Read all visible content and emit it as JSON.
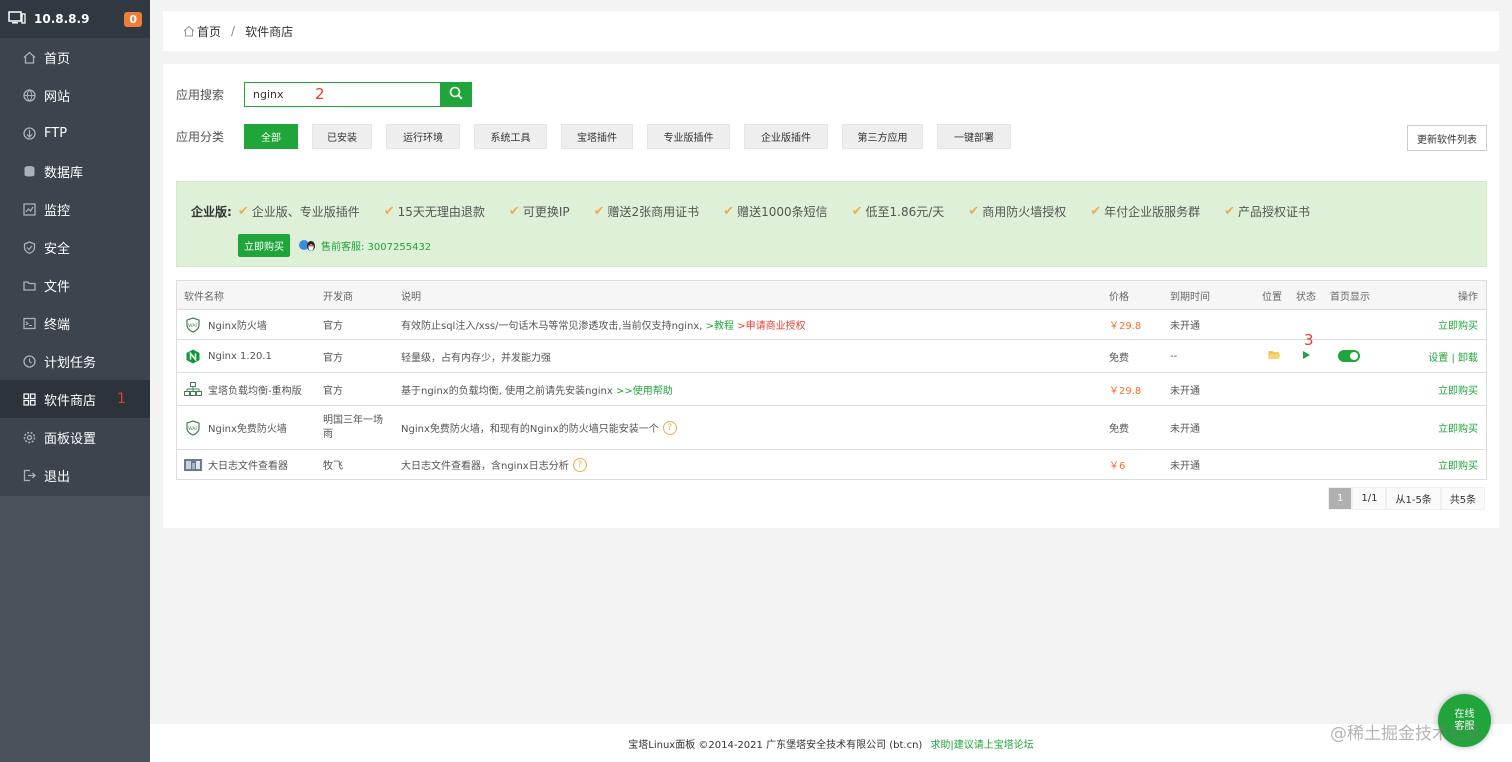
{
  "sidebar": {
    "host": "10.8.8.9",
    "badge": "0",
    "items": [
      {
        "label": "首页",
        "icon": "home-icon"
      },
      {
        "label": "网站",
        "icon": "globe-icon"
      },
      {
        "label": "FTP",
        "icon": "ftp-icon"
      },
      {
        "label": "数据库",
        "icon": "database-icon"
      },
      {
        "label": "监控",
        "icon": "monitor-icon"
      },
      {
        "label": "安全",
        "icon": "shield-icon"
      },
      {
        "label": "文件",
        "icon": "folder-icon"
      },
      {
        "label": "终端",
        "icon": "terminal-icon"
      },
      {
        "label": "计划任务",
        "icon": "clock-icon"
      },
      {
        "label": "软件商店",
        "icon": "grid-icon",
        "active": true,
        "marker": "1"
      },
      {
        "label": "面板设置",
        "icon": "gear-icon"
      },
      {
        "label": "退出",
        "icon": "logout-icon"
      }
    ]
  },
  "breadcrumb": {
    "home": "首页",
    "sep": "/",
    "current": "软件商店"
  },
  "search": {
    "label": "应用搜索",
    "value": "nginx",
    "marker": "2"
  },
  "categories": {
    "label": "应用分类",
    "items": [
      "全部",
      "已安装",
      "运行环境",
      "系统工具",
      "宝塔插件",
      "专业版插件",
      "企业版插件",
      "第三方应用",
      "一键部署"
    ],
    "refresh": "更新软件列表"
  },
  "promo": {
    "title": "企业版:",
    "features": [
      "企业版、专业版插件",
      "15天无理由退款",
      "可更换IP",
      "赠送2张商用证书",
      "赠送1000条短信",
      "低至1.86元/天",
      "商用防火墙授权",
      "年付企业版服务群",
      "产品授权证书"
    ],
    "buy": "立即购买",
    "service": "售前客服: 3007255432"
  },
  "table": {
    "headers": [
      "软件名称",
      "开发商",
      "说明",
      "价格",
      "到期时间",
      "位置",
      "状态",
      "首页显示",
      "操作"
    ],
    "rows": [
      {
        "name": "Nginx防火墙",
        "vendor": "官方",
        "desc": "有效防止sql注入/xss/一句话木马等常见渗透攻击,当前仅支持nginx, ",
        "link1": ">教程",
        "link2": ">申请商业授权",
        "price": "￥29.8",
        "expire": "未开通",
        "action": "立即购买"
      },
      {
        "name": "Nginx 1.20.1",
        "vendor": "官方",
        "desc": "轻量级，占有内存少，并发能力强",
        "price": "免费",
        "expire": "--",
        "action1": "设置",
        "action_sep": "|",
        "action2": "卸载",
        "marker": "3"
      },
      {
        "name": "宝塔负载均衡-重构版",
        "vendor": "官方",
        "desc": "基于nginx的负载均衡, 使用之前请先安装nginx ",
        "link1": ">>使用帮助",
        "price": "￥29.8",
        "expire": "未开通",
        "action": "立即购买"
      },
      {
        "name": "Nginx免费防火墙",
        "vendor": "明国三年一场雨",
        "desc": "Nginx免费防火墙，和现有的Nginx的防火墙只能安装一个",
        "price": "免费",
        "expire": "未开通",
        "action": "立即购买"
      },
      {
        "name": "大日志文件查看器",
        "vendor": "牧飞",
        "desc": "大日志文件查看器，含nginx日志分析",
        "price": "￥6",
        "expire": "未开通",
        "action": "立即购买"
      }
    ]
  },
  "pager": {
    "current": "1",
    "pages": "1/1",
    "range": "从1-5条",
    "total": "共5条"
  },
  "footer": {
    "copy": "宝塔Linux面板 ©2014-2021 广东堡塔安全技术有限公司 (bt.cn)",
    "link": "求助|建议请上宝塔论坛"
  },
  "chat": {
    "label": "在线\n客服"
  },
  "watermark": "@稀土掘金技术社区",
  "colors": {
    "accent": "#20a53a",
    "price": "#fc6d26",
    "marker": "#e53e30"
  }
}
